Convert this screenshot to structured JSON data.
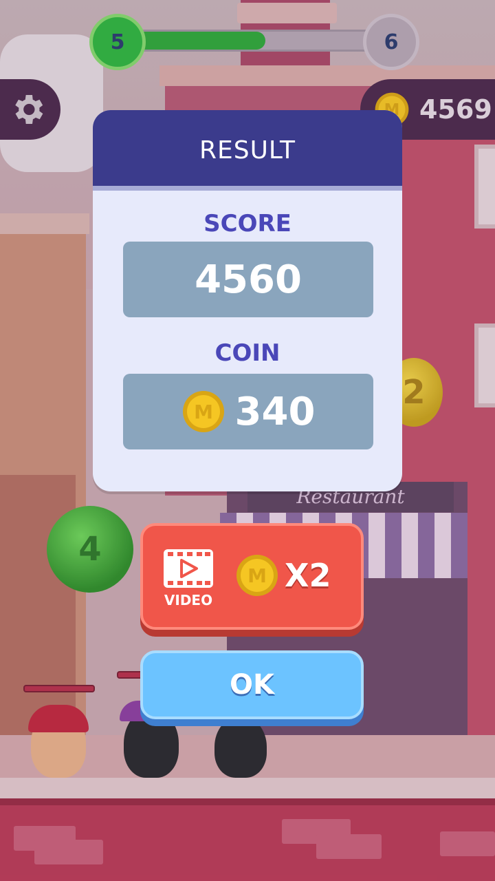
{
  "hud": {
    "level_current": "5",
    "level_next": "6",
    "level_progress": 0.55,
    "coin_total": "4569"
  },
  "background": {
    "sign_text": "Restaurant",
    "bubble_green": "4",
    "bubble_yellow": "2"
  },
  "dialog": {
    "title": "RESULT",
    "score_label": "SCORE",
    "score_value": "4560",
    "coin_label": "COIN",
    "coin_value": "340"
  },
  "buttons": {
    "video_label": "VIDEO",
    "multiplier_label": "X2",
    "ok_label": "OK"
  },
  "colors": {
    "dialog_header": "#3b3b8c",
    "video_button": "#f0564a",
    "ok_button": "#6cc3ff",
    "coin": "#f5c623"
  },
  "icons": {
    "settings": "gear-icon",
    "coin": "coin-icon",
    "video": "video-icon"
  }
}
